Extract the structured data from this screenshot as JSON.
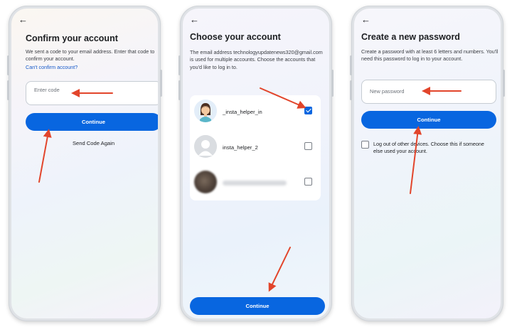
{
  "screens": [
    {
      "back_icon": "arrow-left-icon",
      "title": "Confirm your account",
      "description": "We sent a code to your email address. Enter that code to confirm your account.",
      "link": "Can't confirm account?",
      "input": {
        "placeholder": "Enter code",
        "value": ""
      },
      "primary_button": "Continue",
      "secondary_link": "Send Code Again"
    },
    {
      "back_icon": "arrow-left-icon",
      "title": "Choose your account",
      "description": "The email address technologyupdatenews320@gmail.com is used for multiple accounts. Choose the accounts that you'd like to log in to.",
      "accounts": [
        {
          "username": "_insta_helper_in",
          "checked": true,
          "avatar": "cartoon-user-avatar"
        },
        {
          "username": "insta_helper_2",
          "checked": false,
          "avatar": "default-user-avatar"
        },
        {
          "username": "",
          "checked": false,
          "avatar": "blurred-photo-avatar"
        }
      ],
      "primary_button": "Continue"
    },
    {
      "back_icon": "arrow-left-icon",
      "title": "Create a new password",
      "description": "Create a password with at least 6 letters and numbers. You'll need this password to log in to your account.",
      "input": {
        "placeholder": "New password",
        "value": ""
      },
      "primary_button": "Continue",
      "logout_option": {
        "label": "Log out of other devices. Choose this if someone else used your account.",
        "checked": false
      }
    }
  ],
  "colors": {
    "primary": "#0866e0",
    "annotation_arrow": "#e2452b",
    "link": "#1659c9"
  },
  "annotation_icon": "red-arrow-icon"
}
